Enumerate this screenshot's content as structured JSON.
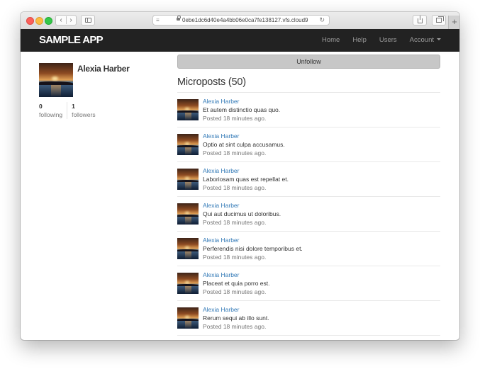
{
  "browser": {
    "reader_icon": "reader-mode-icon",
    "url": "0ebe1dc6d40e4a4bb06e0ca7fe138127.vfs.cloud9",
    "nav_back": "‹",
    "nav_forward": "›",
    "reload": "↻",
    "new_tab": "+"
  },
  "navbar": {
    "brand": "SAMPLE APP",
    "links": [
      "Home",
      "Help",
      "Users"
    ],
    "account": "Account"
  },
  "profile": {
    "name": "Alexia Harber",
    "following_count": "0",
    "following_label": "following",
    "followers_count": "1",
    "followers_label": "followers"
  },
  "actions": {
    "unfollow": "Unfollow"
  },
  "microposts": {
    "heading": "Microposts (50)",
    "items": [
      {
        "user": "Alexia Harber",
        "content": "Et autem distinctio quas quo.",
        "time": "Posted 18 minutes ago."
      },
      {
        "user": "Alexia Harber",
        "content": "Optio at sint culpa accusamus.",
        "time": "Posted 18 minutes ago."
      },
      {
        "user": "Alexia Harber",
        "content": "Laboriosam quas est repellat et.",
        "time": "Posted 18 minutes ago."
      },
      {
        "user": "Alexia Harber",
        "content": "Qui aut ducimus ut doloribus.",
        "time": "Posted 18 minutes ago."
      },
      {
        "user": "Alexia Harber",
        "content": "Perferendis nisi dolore temporibus et.",
        "time": "Posted 18 minutes ago."
      },
      {
        "user": "Alexia Harber",
        "content": "Placeat et quia porro est.",
        "time": "Posted 18 minutes ago."
      },
      {
        "user": "Alexia Harber",
        "content": "Rerum sequi ab illo sunt.",
        "time": "Posted 18 minutes ago."
      }
    ]
  },
  "colors": {
    "navbar_bg": "#222222",
    "link": "#337ab7",
    "muted": "#777777",
    "button_bg": "#c7c7c7"
  }
}
